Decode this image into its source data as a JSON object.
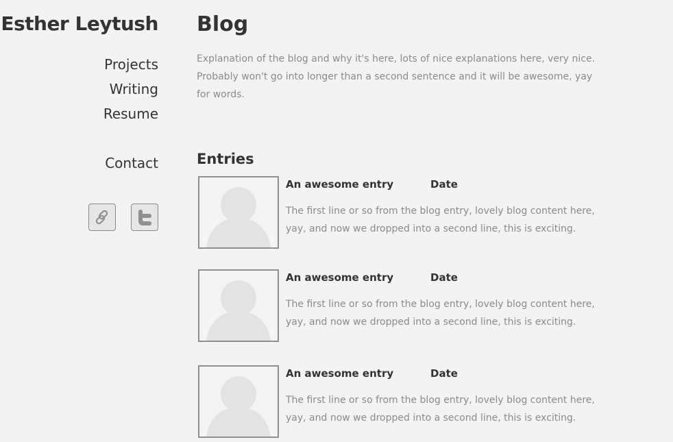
{
  "site": {
    "name": "Esther Leytush"
  },
  "nav": {
    "items": [
      {
        "label": "Projects"
      },
      {
        "label": "Writing"
      },
      {
        "label": "Resume"
      }
    ],
    "contact_label": "Contact"
  },
  "social": [
    {
      "icon": "link-icon"
    },
    {
      "icon": "twitter-icon"
    }
  ],
  "blog": {
    "title": "Blog",
    "intro": "Explanation of the blog and why it's here, lots of nice explanations here, very nice. Probably won't go into longer than a second sentence and it will be awesome, yay for words.",
    "entries_heading": "Entries",
    "entries": [
      {
        "title": "An awesome entry",
        "date": "Date",
        "excerpt": "The first line or so from the blog entry, lovely blog content here, yay, and now we dropped into a second line, this is exciting.",
        "thumbnail_icon": "avatar-placeholder-icon"
      },
      {
        "title": "An awesome entry",
        "date": "Date",
        "excerpt": "The first line or so from the blog entry, lovely blog content here, yay, and now we dropped into a second line, this is exciting.",
        "thumbnail_icon": "avatar-placeholder-icon"
      },
      {
        "title": "An awesome entry",
        "date": "Date",
        "excerpt": "The first line or so from the blog entry, lovely blog content here, yay, and now we dropped into a second line, this is exciting.",
        "thumbnail_icon": "avatar-placeholder-icon"
      }
    ]
  },
  "colors": {
    "background": "#f3f3f3",
    "text": "#333333",
    "muted_text": "#8a8a8a",
    "border": "#8f8f8f",
    "placeholder": "#e3e3e3"
  }
}
